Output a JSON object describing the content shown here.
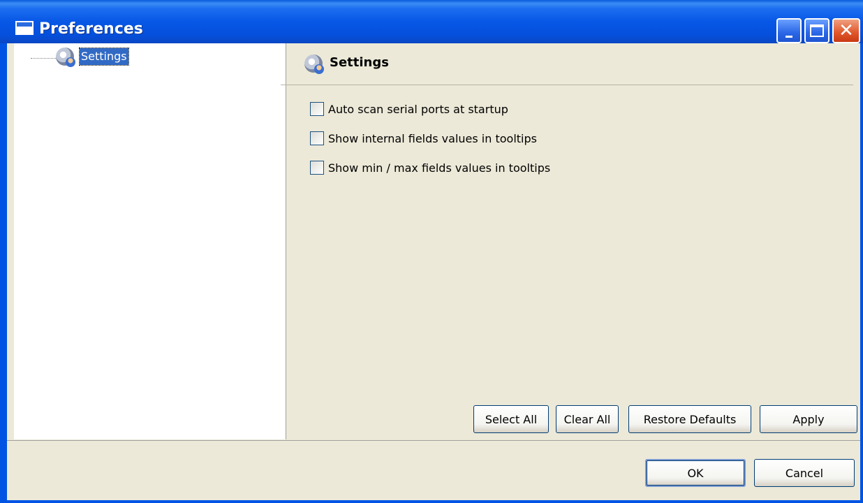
{
  "window": {
    "title": "Preferences"
  },
  "tree": {
    "items": [
      {
        "label": "Settings",
        "selected": true
      }
    ]
  },
  "content": {
    "title": "Settings",
    "checkboxes": [
      {
        "label": "Auto scan serial ports at startup",
        "checked": false
      },
      {
        "label": "Show internal fields values in tooltips",
        "checked": false
      },
      {
        "label": "Show min / max fields values in tooltips",
        "checked": false
      }
    ],
    "buttons": {
      "select_all": "Select All",
      "clear_all": "Clear All",
      "restore_defaults": "Restore Defaults",
      "apply": "Apply"
    }
  },
  "footer": {
    "ok": "OK",
    "cancel": "Cancel"
  },
  "colors": {
    "title_bar": "#0054e3",
    "selection": "#316ac5",
    "dialog_bg": "#ece9d8"
  }
}
